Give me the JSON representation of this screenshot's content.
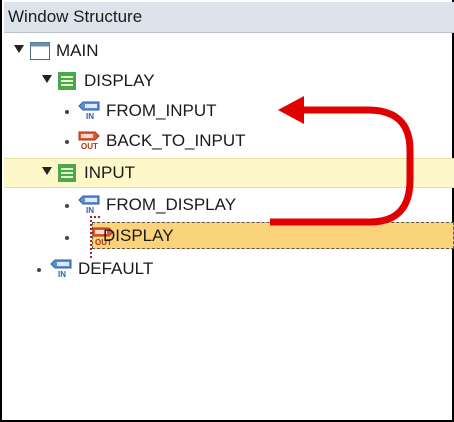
{
  "header": {
    "title": "Window Structure"
  },
  "tree": {
    "main": {
      "label": "MAIN"
    },
    "display": {
      "label": "DISPLAY"
    },
    "display_from_input": {
      "label": "FROM_INPUT"
    },
    "display_back_to_input": {
      "label": "BACK_TO_INPUT"
    },
    "input": {
      "label": "INPUT"
    },
    "input_from_display": {
      "label": "FROM_DISPLAY"
    },
    "input_display": {
      "label": "DISPLAY"
    },
    "default": {
      "label": "DEFAULT"
    }
  },
  "icons": {
    "window": "window-icon",
    "view": "view-icon",
    "inbound_plug": "inbound-plug-icon",
    "outbound_plug": "outbound-plug-icon",
    "plug_in_text": "IN",
    "plug_out_text": "OUT"
  },
  "colors": {
    "header_bg": "#dde3ea",
    "input_row_bg": "#fdf7c9",
    "selected_row_bg": "#fbd37a",
    "arrow": "#e00000"
  }
}
